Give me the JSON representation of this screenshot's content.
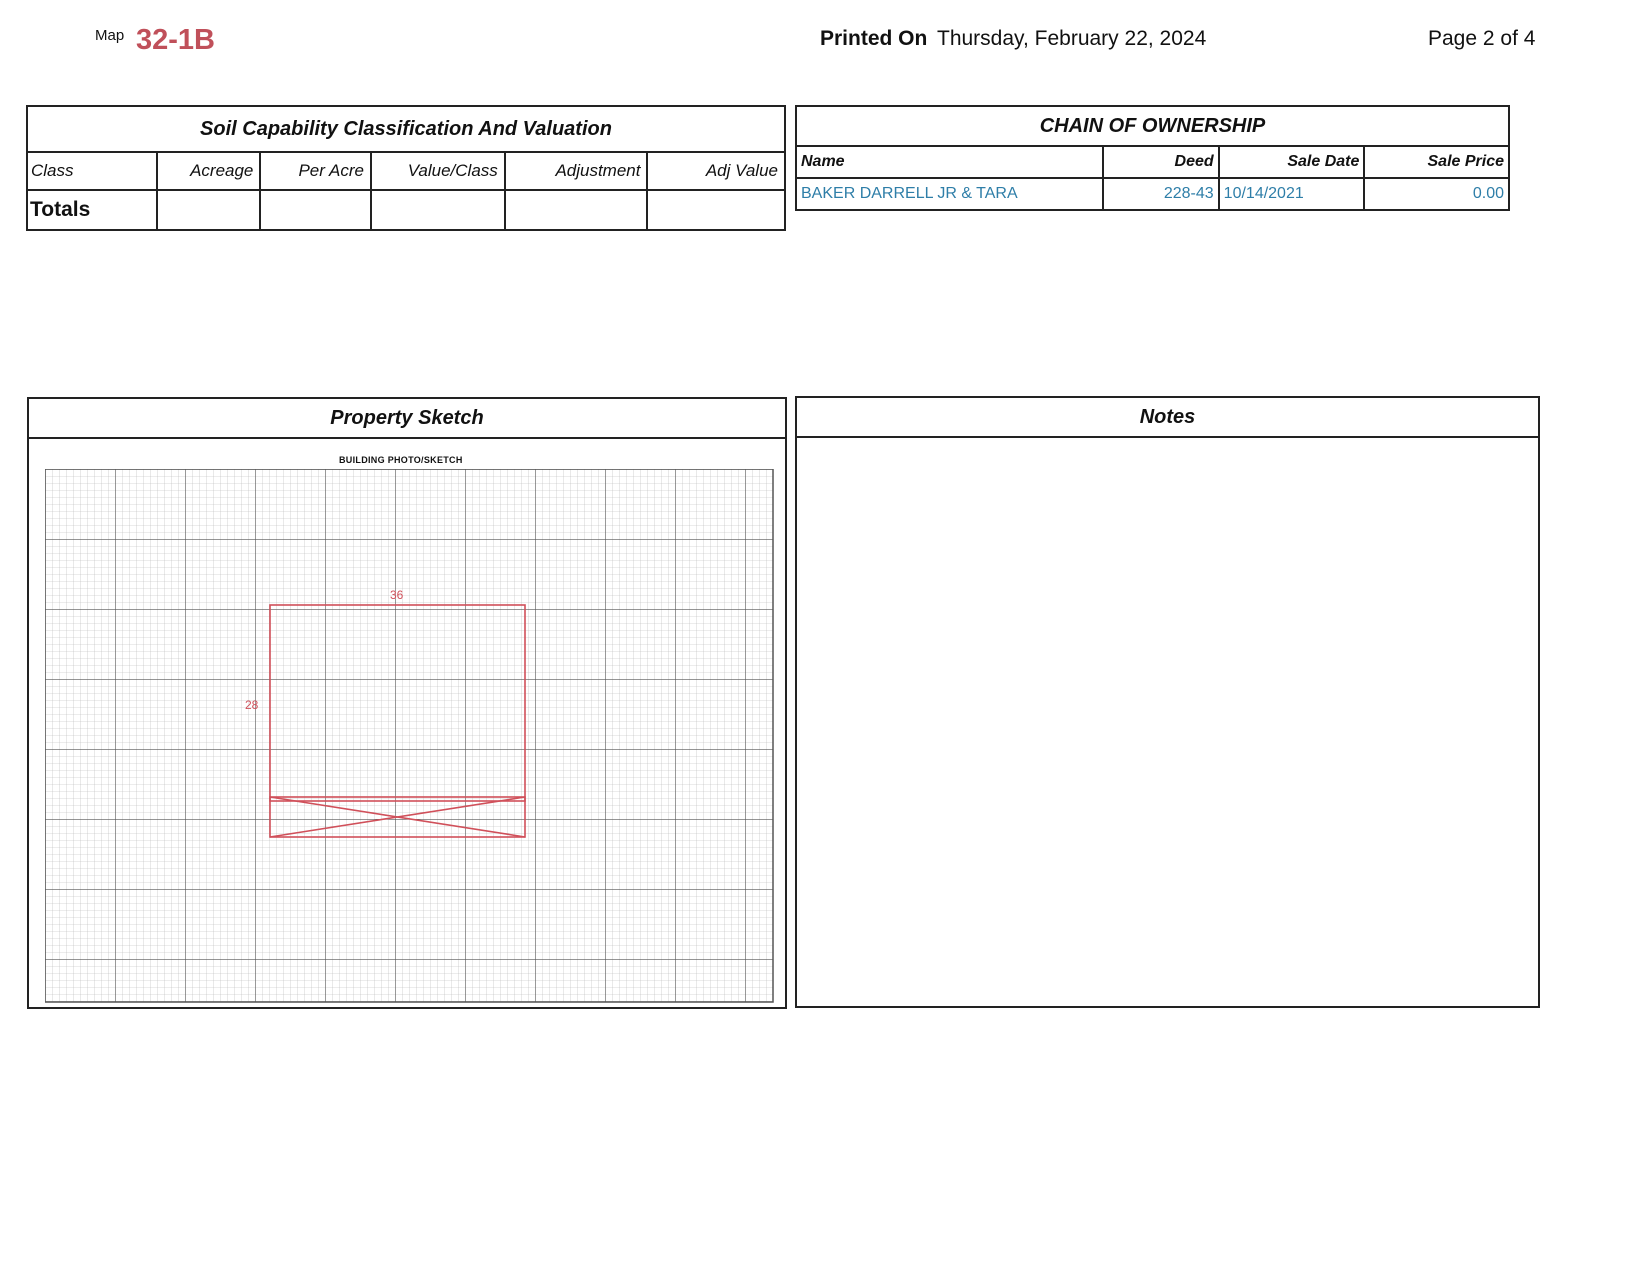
{
  "header": {
    "map_label": "Map",
    "map_id": "32-1B",
    "printed_label": "Printed On",
    "printed_date": "Thursday, February 22, 2024",
    "page_info": "Page 2 of 4"
  },
  "soil": {
    "title": "Soil Capability Classification And Valuation",
    "columns": [
      "Class",
      "Acreage",
      "Per Acre",
      "Value/Class",
      "Adjustment",
      "Adj Value"
    ],
    "totals_label": "Totals"
  },
  "chain": {
    "title": "CHAIN OF OWNERSHIP",
    "columns": [
      "Name",
      "Deed",
      "Sale Date",
      "Sale Price"
    ],
    "rows": [
      {
        "name": "BAKER DARRELL JR & TARA",
        "deed": "228-43",
        "sale_date": "10/14/2021",
        "sale_price": "0.00"
      }
    ]
  },
  "sketch": {
    "title": "Property Sketch",
    "caption": "BUILDING PHOTO/SKETCH",
    "dim_top": "36",
    "dim_side": "28"
  },
  "notes": {
    "title": "Notes"
  }
}
